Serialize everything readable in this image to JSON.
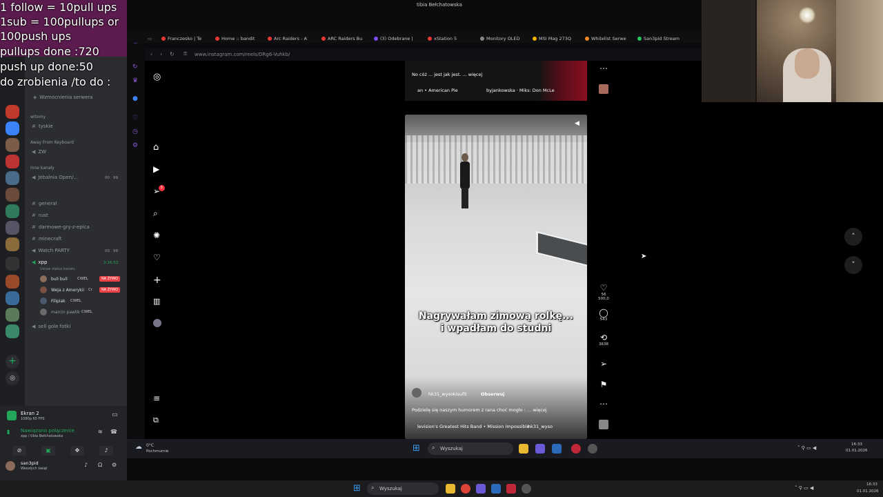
{
  "overlay": {
    "lines": [
      "1 follow = 10pull ups",
      "1sub = 100pullups or",
      "100push ups",
      "pullups done :720",
      "push up done:50",
      "do zrobienia /to do :"
    ]
  },
  "window_title": "tibia Bełchatowska",
  "browser": {
    "url": "www.instagram.com/reels/DRg6-Vuhkb/",
    "tabs": [
      {
        "label": "Franczesko | Te",
        "color": "#e53935"
      },
      {
        "label": "Home :: bandit",
        "color": "#e53935"
      },
      {
        "label": "Arc Raiders - A",
        "color": "#e53935"
      },
      {
        "label": "ARC Raiders Bu",
        "color": "#e53935"
      },
      {
        "label": "(3) Odebrane |",
        "color": "#7c4dff"
      },
      {
        "label": "xStation 5",
        "color": "#e53935"
      },
      {
        "label": "Monitory OLED",
        "color": "#888888"
      },
      {
        "label": "MSI Mag 273Q",
        "color": "#f5b400"
      },
      {
        "label": "Whitelist Serwe",
        "color": "#f08a24"
      },
      {
        "label": "San3pid Stream",
        "color": "#22c55e"
      }
    ]
  },
  "discord": {
    "header": "Wzmocnienia serwera",
    "categories": [
      {
        "label": "witomy",
        "channels": [
          "tyskie"
        ]
      },
      {
        "label": "Away From Keyboard",
        "channels": [
          "ZW"
        ]
      },
      {
        "label": "inne kanały",
        "channels": [
          "Jebalnia Open/..."
        ]
      }
    ],
    "text_channels": [
      "general",
      "rust",
      "darmowe-gry-z-epica",
      "minecraft"
    ],
    "voice_watch_party": "Watch PARTY",
    "voice_xpp": "xpp",
    "voice_xpp_time": "3:16:52",
    "voice_xpp_status": "Ustaw status kanału",
    "voice_users": [
      {
        "name": "buli buli",
        "tag": "CWEL",
        "live": "NA ŻYWO"
      },
      {
        "name": "Weja z Amerykii",
        "tag": "Cr",
        "live": "NA ŻYWO"
      },
      {
        "name": "Filipiak",
        "tag": "CWEL",
        "live": ""
      },
      {
        "name": "marcin pawlik",
        "tag": "CWEL",
        "live": ""
      }
    ],
    "voice_last": "sell gole fotki",
    "counts": [
      "00",
      "99",
      "00",
      "99"
    ],
    "screen_share": {
      "title": "Ekran 2",
      "sub": "1080p 60 FPS"
    },
    "voice_connected": {
      "title": "Nawiązano połączenie",
      "sub": "xpp / tibia Bełchatowska"
    },
    "user": {
      "name": "san3pid",
      "status": "Wesołych świąt"
    }
  },
  "instagram": {
    "top_reel": {
      "caption": "No cóż ... jest jak jest. ... więcej",
      "music": "an • American Pie",
      "author_audio": "byjankowska · Miks: Don McLe"
    },
    "main_reel": {
      "overlay_line1": "Nagrywałam zimową rolkę...",
      "overlay_line2": "i wpadłam do studni",
      "author": "hk31_wysokisufit",
      "follow": "Obserwuj",
      "caption": "Podzielę się naszym humorem z rana choć mogło : ... więcej",
      "music": "levision's Greatest Hits Band • Mission Impossible",
      "audio_author": "hk31_wyso"
    },
    "actions": {
      "likes": "56 500,0",
      "comments": "543",
      "reposts": "3638"
    },
    "notif_badge": "5"
  },
  "taskbar_inner": {
    "weather_temp": "0°C",
    "weather_desc": "Pochmurnie",
    "search": "Wyszukaj",
    "time": "16:33",
    "date": "01.01.2026"
  },
  "taskbar_outer": {
    "search": "Wyszukaj",
    "time": "16:33",
    "date": "01.01.2026"
  }
}
